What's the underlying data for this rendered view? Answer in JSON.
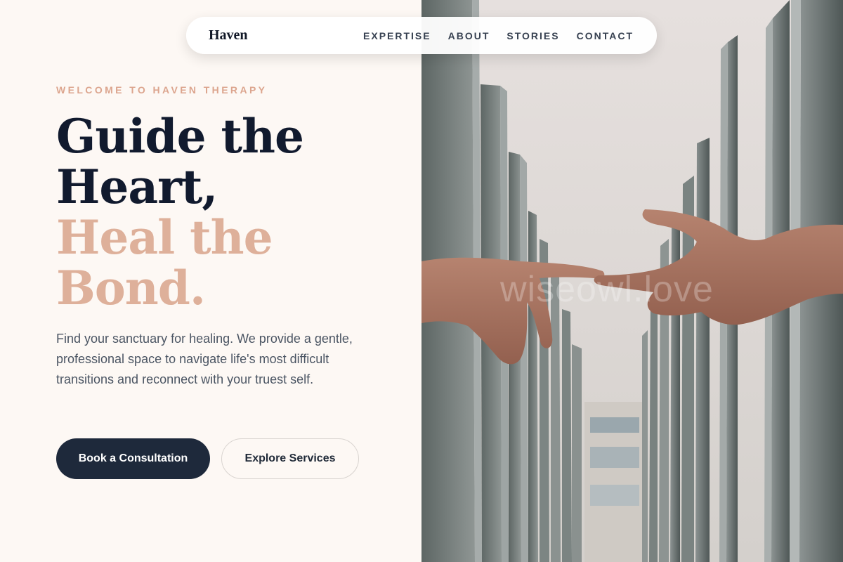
{
  "nav": {
    "brand": "Haven",
    "links": [
      "EXPERTISE",
      "ABOUT",
      "STORIES",
      "CONTACT"
    ]
  },
  "hero": {
    "eyebrow": "WELCOME TO HAVEN THERAPY",
    "headline_line1": "Guide the",
    "headline_line2": "Heart,",
    "headline_line3": "Heal the",
    "headline_line4": "Bond.",
    "description": "Find your sanctuary for healing. We provide a gentle, professional space to navigate life's most difficult transitions and reconnect with your truest self.",
    "primary_button": "Book a Consultation",
    "secondary_button": "Explore Services",
    "watermark": "wiseowl.love"
  },
  "colors": {
    "background": "#fdf8f4",
    "navy": "#111a2e",
    "accent": "#deb09a",
    "eyebrow": "#dca58e",
    "button_dark": "#1e293b"
  }
}
